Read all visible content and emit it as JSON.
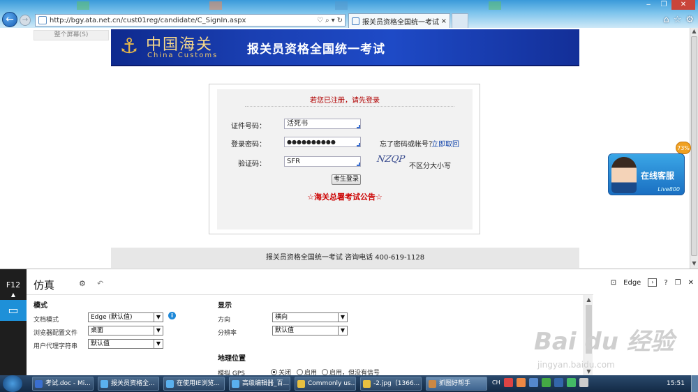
{
  "browser": {
    "url": "http://bgy.ata.net.cn/cust01reg/candidate/C_SignIn.aspx",
    "tab_title": "报关员资格全国统一考试",
    "tab_close": "×"
  },
  "page": {
    "fullscreen_label": "整个屏幕(S)",
    "logo_cn": "中国海关",
    "logo_en": "China Customs",
    "banner_title": "报关员资格全国统一考试",
    "login": {
      "notice": "若您已注册，请先登录",
      "id_label": "证件号码：",
      "id_value": "活死书",
      "password_label": "登录密码：",
      "password_value": "●●●●●●●●●●",
      "forgot_text": "忘了密码或帐号？",
      "forgot_link": "立即取回",
      "captcha_label": "验证码：",
      "captcha_value": "SFR",
      "captcha_image_text": "NZQP",
      "captcha_hint": "不区分大小写",
      "login_button": "考生登录",
      "announcement": "☆海关总署考试公告☆"
    },
    "footer": "报关员资格全国统一考试 咨询电话 400-619-1128",
    "chat": {
      "label": "在线客服",
      "brand": "Live800",
      "badge": "73%"
    }
  },
  "devtools": {
    "f12": "F12",
    "title": "仿真",
    "right_mode": "Edge",
    "help": "?",
    "mode_section": "模式",
    "doc_mode_label": "文档模式",
    "doc_mode_value": "Edge (默认值)",
    "browser_profile_label": "浏览器配置文件",
    "browser_profile_value": "桌面",
    "ua_label": "用户代理字符串",
    "ua_value": "默认值",
    "display_section": "显示",
    "orientation_label": "方向",
    "orientation_value": "横向",
    "resolution_label": "分辨率",
    "resolution_value": "默认值",
    "geo_section": "地理位置",
    "gps_label": "模拟 GPS",
    "gps_options": [
      "关闭",
      "启用",
      "启用，但没有信号"
    ]
  },
  "watermark": {
    "main": "Bai du 经验",
    "sub": "jingyan.baidu.com"
  },
  "taskbar": {
    "items": [
      "考试.doc - Mi...",
      "报关员资格全...",
      "在使用IE浏览...",
      "高级编辑器_百...",
      "Commonly us...",
      "-2.jpg（1366...",
      "抓图好帮手"
    ],
    "lang": "CH",
    "clock": "15:51"
  },
  "colors": {
    "banner": "#1a3fb2",
    "notice": "#b00000",
    "link": "#1144aa",
    "devtools_accent": "#1e90d8"
  }
}
